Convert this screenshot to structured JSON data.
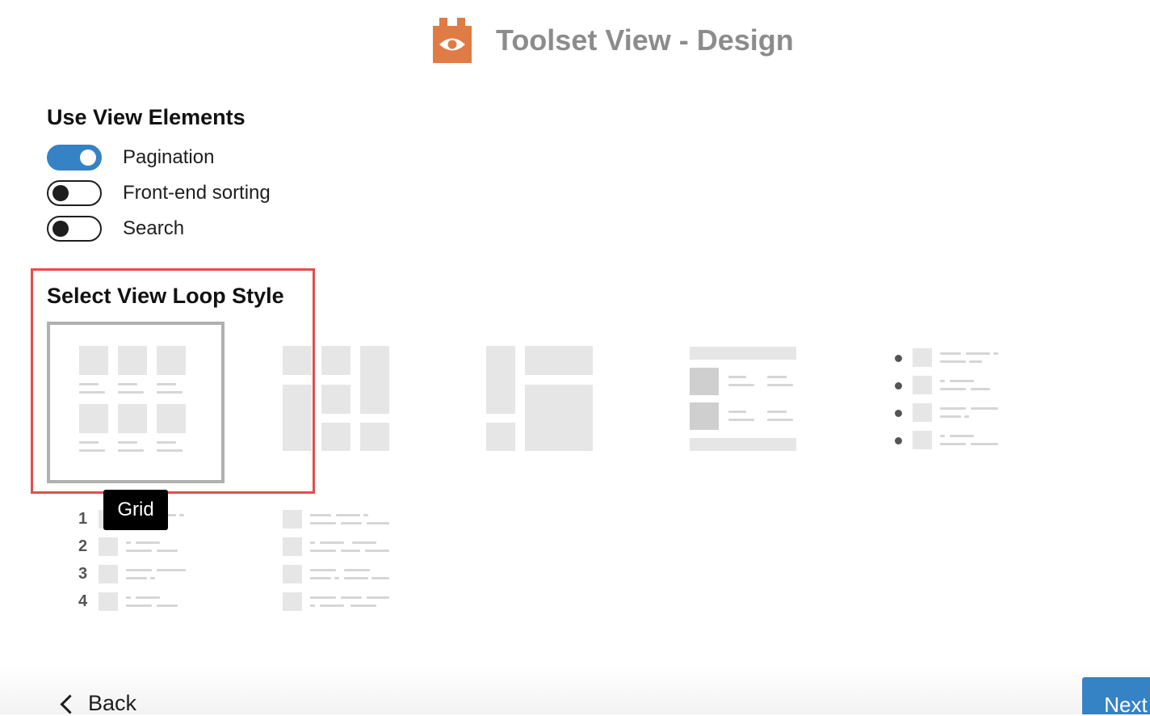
{
  "header": {
    "title": "Toolset View - Design",
    "logo_icon": "toolset-eye-logo"
  },
  "elements_section": {
    "title": "Use View Elements",
    "toggles": [
      {
        "label": "Pagination",
        "on": true
      },
      {
        "label": "Front-end sorting",
        "on": false
      },
      {
        "label": "Search",
        "on": false
      }
    ]
  },
  "loop_section": {
    "title": "Select View Loop Style",
    "options": [
      "grid",
      "masonry",
      "mixed-layout",
      "table",
      "unordered-list",
      "ordered-list",
      "bootstrap-list"
    ],
    "selected": "grid",
    "tooltip": "Grid",
    "ordered_numbers": [
      "1",
      "2",
      "3",
      "4"
    ]
  },
  "footer": {
    "back_label": "Back",
    "next_label": "Next"
  },
  "colors": {
    "accent": "#3582c4",
    "logo": "#e07b45",
    "highlight": "#e74c4c"
  }
}
